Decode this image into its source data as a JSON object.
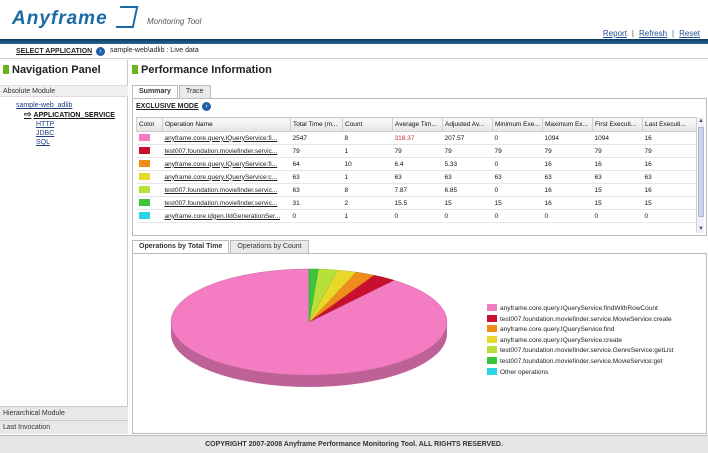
{
  "header": {
    "logo": "Anyframe",
    "subtitle": "Monitoring Tool",
    "links": [
      "Report",
      "Refresh",
      "Reset"
    ]
  },
  "app_select": {
    "label": "SELECT APPLICATION",
    "value": "sample-web\\adlib : Live data"
  },
  "nav": {
    "title": "Navigation Panel",
    "absolute_module": "Absolute Module",
    "root": "sample-web_adlib",
    "service": "APPLICATION_SERVICE",
    "children": [
      "HTTP",
      "JDBC",
      "SQL"
    ],
    "hierarchical_module": "Hierarchical Module",
    "last_invocation": "Last Invocation"
  },
  "perf": {
    "title": "Performance Information",
    "tabs": [
      "Summary",
      "Trace"
    ],
    "exclusive_mode": "EXCLUSIVE MODE",
    "columns": [
      "Color",
      "Operation Name",
      "Total Time (m...",
      "Count",
      "Average Tim...",
      "Adjusted Av...",
      "Minimum Exe...",
      "Maximum Ex...",
      "First Executi...",
      "Last Executi..."
    ],
    "rows": [
      {
        "color": "#f47cc2",
        "cells": [
          "anyframe.core.query.IQueryService:fi...",
          "2547",
          "8",
          "318.37",
          "207.57",
          "0",
          "1094",
          "1094",
          "16"
        ]
      },
      {
        "color": "#c8102e",
        "cells": [
          "test007.foundation.moviefinder.servic...",
          "79",
          "1",
          "79",
          "79",
          "79",
          "79",
          "79",
          "79"
        ]
      },
      {
        "color": "#f08c1c",
        "cells": [
          "anyframe.core.query.IQueryService:fi...",
          "64",
          "10",
          "6.4",
          "5.33",
          "0",
          "16",
          "16",
          "16"
        ]
      },
      {
        "color": "#e8d82a",
        "cells": [
          "anyframe.core.query.IQueryService:c...",
          "63",
          "1",
          "63",
          "63",
          "63",
          "63",
          "63",
          "63"
        ]
      },
      {
        "color": "#b8e03a",
        "cells": [
          "test007.foundation.moviefinder.servic...",
          "63",
          "8",
          "7.87",
          "6.85",
          "0",
          "16",
          "15",
          "16"
        ]
      },
      {
        "color": "#3cc43c",
        "cells": [
          "test007.foundation.moviefinder.servic...",
          "31",
          "2",
          "15.5",
          "15",
          "15",
          "16",
          "15",
          "15"
        ]
      },
      {
        "color": "#2ad4e0",
        "cells": [
          "anyframe.core.idgen.IIdGenerationSer...",
          "0",
          "1",
          "0",
          "0",
          "0",
          "0",
          "0",
          "0"
        ]
      }
    ],
    "chart_tabs": [
      "Operations by Total Time",
      "Operations by Count"
    ]
  },
  "chart_data": {
    "type": "pie",
    "title": "",
    "categories": [
      "anyframe.core.query.IQueryService:findWithRowCount",
      "test007.foundation.moviefinder.service.MovieService:create",
      "anyframe.core.query.IQueryService:find",
      "anyframe.core.query.IQueryService:create",
      "test007.foundation.moviefinder.service.GenreService:getList",
      "test007.foundation.moviefinder.service.MovieService:get",
      "Other operations"
    ],
    "values": [
      2547,
      79,
      64,
      63,
      63,
      31,
      0
    ],
    "colors": [
      "#f47cc2",
      "#c8102e",
      "#f08c1c",
      "#e8d82a",
      "#b8e03a",
      "#3cc43c",
      "#2ad4e0"
    ],
    "legend_position": "right"
  },
  "footer": {
    "text": "COPYRIGHT 2007-2008 Anyframe Performance Monitoring Tool. ALL RIGHTS RESERVED."
  }
}
